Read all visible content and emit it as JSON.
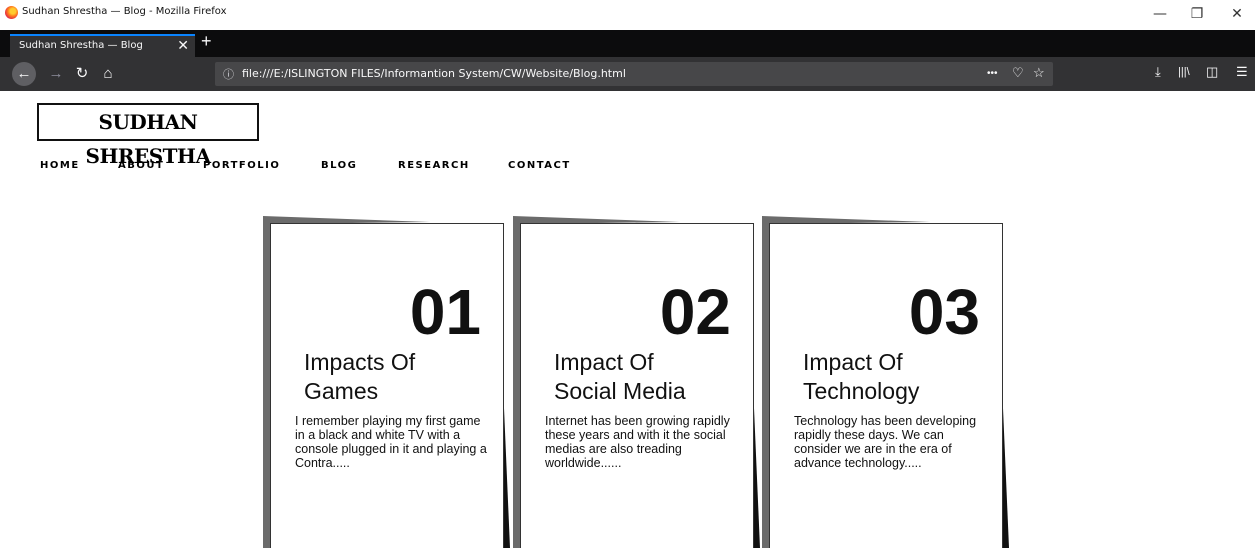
{
  "window": {
    "title": "Sudhan Shrestha — Blog - Mozilla Firefox",
    "minimize_glyph": "—",
    "restore_glyph": "❐",
    "close_glyph": "✕"
  },
  "tabs": [
    {
      "label": "Sudhan Shrestha — Blog",
      "close_glyph": "✕"
    }
  ],
  "toolbar": {
    "new_tab_glyph": "+",
    "back_glyph": "←",
    "forward_glyph": "→",
    "reload_glyph": "↻",
    "home_glyph": "⌂",
    "info_glyph": "ⓘ",
    "url": "file:///E:/ISLINGTON FILES/Informantion System/CW/Website/Blog.html",
    "page_actions_glyph": "•••",
    "pocket_glyph": "♡",
    "bookmark_glyph": "☆",
    "download_glyph": "⤓",
    "library_glyph": "|||\\",
    "sidebar_glyph": "◫",
    "menu_glyph": "☰"
  },
  "site": {
    "logo": "SUDHAN SHRESTHA",
    "nav": [
      "HOME",
      "ABOUT",
      "PORTFOLIO",
      "BLOG",
      "RESEARCH",
      "CONTACT"
    ]
  },
  "cards": [
    {
      "number": "01",
      "title_line1": "Impacts Of",
      "title_line2": "Games",
      "text": "I remember playing my first game in a black and white TV with a console plugged in it and playing a Contra....."
    },
    {
      "number": "02",
      "title_line1": "Impact Of",
      "title_line2": "Social Media",
      "text": "Internet has been growing rapidly these years and with it the social medias are also treading worldwide......"
    },
    {
      "number": "03",
      "title_line1": "Impact Of",
      "title_line2": "Technology",
      "text": "Technology has been developing rapidly these days. We can consider we are in the era of advance technology....."
    }
  ]
}
